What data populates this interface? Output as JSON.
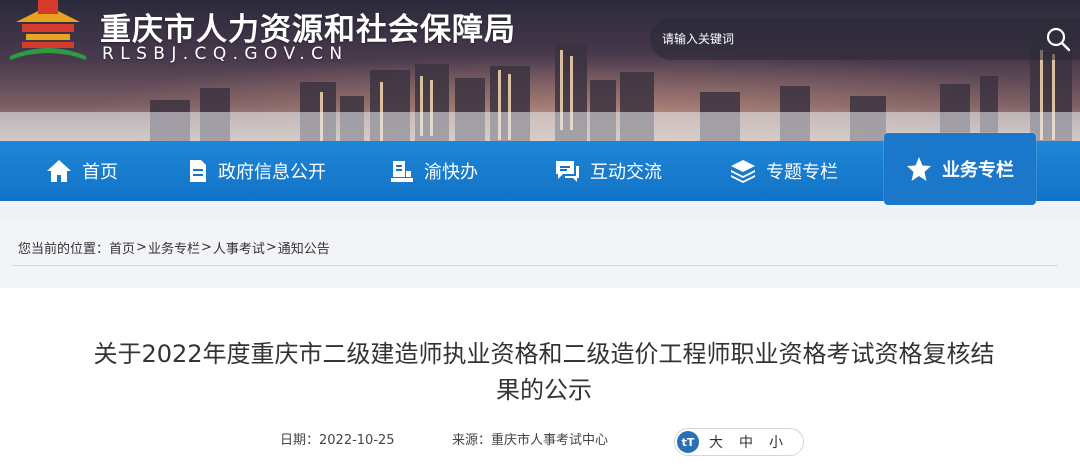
{
  "header": {
    "site_title": "重庆市人力资源和社会保障局",
    "site_domain": "RLSBJ.CQ.GOV.CN",
    "search_placeholder": "请输入关键词"
  },
  "nav": {
    "items": [
      {
        "label": "首页",
        "icon": "home-icon"
      },
      {
        "label": "政府信息公开",
        "icon": "document-icon"
      },
      {
        "label": "渝快办",
        "icon": "service-desk-icon"
      },
      {
        "label": "互动交流",
        "icon": "chat-icon"
      },
      {
        "label": "专题专栏",
        "icon": "layers-icon"
      },
      {
        "label": "业务专栏",
        "icon": "star-icon",
        "active": true
      }
    ]
  },
  "breadcrumb": {
    "prefix": "您当前的位置：",
    "items": [
      "首页",
      "业务专栏",
      "人事考试",
      "通知公告"
    ],
    "separator": ">"
  },
  "article": {
    "title_line1": "关于2022年度重庆市二级建造师执业资格和二级造价工程师职业资格考试资格复核结",
    "title_line2": "果的公示",
    "date": "日期：2022-10-25",
    "source": "来源：重庆市人事考试中心",
    "font_size": {
      "large": "大",
      "medium": "中",
      "small": "小"
    }
  },
  "colors": {
    "nav_bg": "#1273c7",
    "nav_active": "#1a77c9",
    "text": "#333333"
  }
}
